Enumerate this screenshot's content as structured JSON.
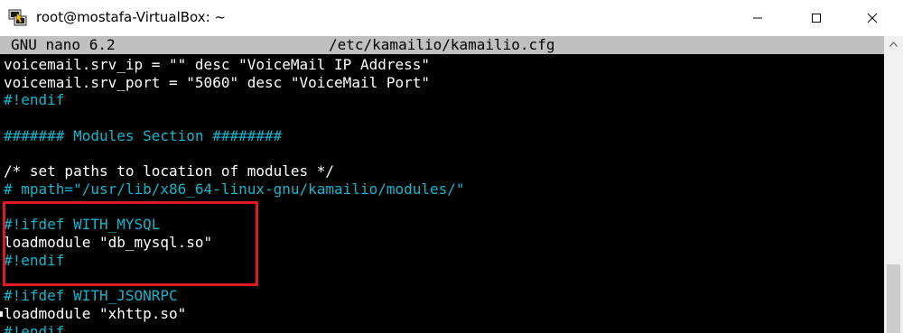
{
  "window": {
    "title": "root@mostafa-VirtualBox: ~",
    "icons": {
      "app": "putty-terminal-icon",
      "minimize": "minimize-icon",
      "maximize": "maximize-icon",
      "close": "close-icon"
    }
  },
  "nano": {
    "version": "GNU nano 6.2",
    "filename": "/etc/kamailio/kamailio.cfg"
  },
  "lines": [
    {
      "text": "voicemail.srv_ip = \"\" desc \"VoiceMail IP Address\"",
      "color": "#ffffff"
    },
    {
      "text": "voicemail.srv_port = \"5060\" desc \"VoiceMail Port\"",
      "color": "#ffffff"
    },
    {
      "text": "#!endif",
      "color": "#12b5cb"
    },
    {
      "text": "",
      "color": "#ffffff"
    },
    {
      "text": "####### Modules Section ########",
      "color": "#12b5cb"
    },
    {
      "text": "",
      "color": "#ffffff"
    },
    {
      "text": "/* set paths to location of modules */",
      "color": "#ffffff"
    },
    {
      "text": "# mpath=\"/usr/lib/x86_64-linux-gnu/kamailio/modules/\"",
      "color": "#12b5cb"
    },
    {
      "text": "",
      "color": "#ffffff"
    },
    {
      "text": "#!ifdef WITH_MYSQL",
      "color": "#12b5cb"
    },
    {
      "text": "loadmodule \"db_mysql.so\"",
      "color": "#ffffff"
    },
    {
      "text": "#!endif",
      "color": "#12b5cb"
    },
    {
      "text": "",
      "color": "#ffffff"
    },
    {
      "text": "#!ifdef WITH_JSONRPC",
      "color": "#12b5cb"
    },
    {
      "text": "loadmodule \"xhttp.so\"",
      "color": "#ffffff"
    },
    {
      "text": "#!endif",
      "color": "#12b5cb"
    }
  ],
  "colors": {
    "terminal_bg": "#000000",
    "comment": "#12b5cb",
    "highlight": "#e01a22",
    "header_bg": "#c0c0c0"
  }
}
